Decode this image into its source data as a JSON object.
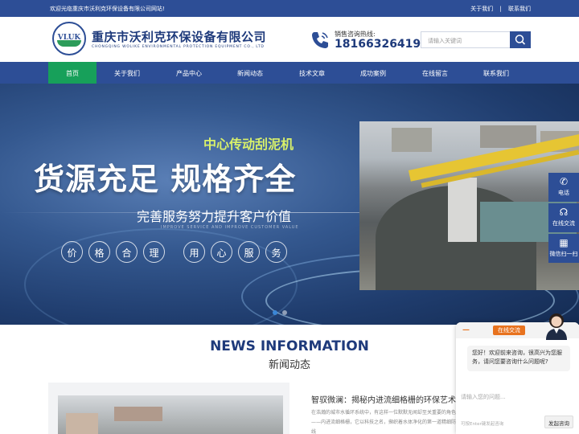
{
  "topbar": {
    "welcome": "欢迎光临重庆市沃利克环保设备有限公司网站!",
    "about_link": "关于我们",
    "separator": "|",
    "contact_link": "联系我们"
  },
  "header": {
    "logo_mark": "VLUK",
    "company_cn": "重庆市沃利克环保设备有限公司",
    "company_en": "CHONGQING WOLIKE ENVIRONMENTAL PROTECTION EQUIPMENT CO., LTD",
    "hotline_label": "销售咨询热线:",
    "hotline_number": "18166326419",
    "search_placeholder": "请输入关键词"
  },
  "nav": {
    "items": [
      {
        "label": "首页",
        "active": true
      },
      {
        "label": "关于我们"
      },
      {
        "label": "产品中心"
      },
      {
        "label": "新闻动态"
      },
      {
        "label": "技术文章"
      },
      {
        "label": "成功案例"
      },
      {
        "label": "在线留言"
      },
      {
        "label": "联系我们"
      }
    ]
  },
  "banner": {
    "sub_title": "中心传动刮泥机",
    "main_slogan": "货源充足 规格齐全",
    "service_line": "完善服务努力提升客户价值",
    "service_en": "IMPROVE SERVICE AND IMPROVE CUSTOMER VALUE",
    "circles": [
      "价",
      "格",
      "合",
      "理",
      "用",
      "心",
      "服",
      "务"
    ],
    "slides_total": 2,
    "slide_active": 1
  },
  "side_tools": {
    "items": [
      {
        "icon": "phone-icon",
        "label": "电话"
      },
      {
        "icon": "headset-icon",
        "label": "在线交流"
      },
      {
        "icon": "qrcode-icon",
        "label": "微信扫一扫"
      }
    ]
  },
  "news": {
    "heading_en": "NEWS INFORMATION",
    "heading_cn": "新闻动态",
    "title": "智驭微澜：揭秘内进流细格栅的环保艺术",
    "excerpt": "在浩瀚的城市水循环系统中，有这样一位默默无闻却至关重要的角色——内进流细格栅，它以科技之名，撷织着水体净化的第一道精细防线"
  },
  "chat": {
    "minimize": "—",
    "tab_label": "在线交流",
    "greeting": "您好！欢迎前来咨询，很高兴为您服务，请问您要咨询什么问题呢?",
    "input_placeholder": "请输入您的问题...",
    "enter_hint": "可按Enter键发起咨询",
    "send_label": "发起咨询"
  },
  "colors": {
    "brand_blue": "#2d4e96",
    "nav_active_green": "#17a05a",
    "chat_orange": "#e8731f"
  }
}
